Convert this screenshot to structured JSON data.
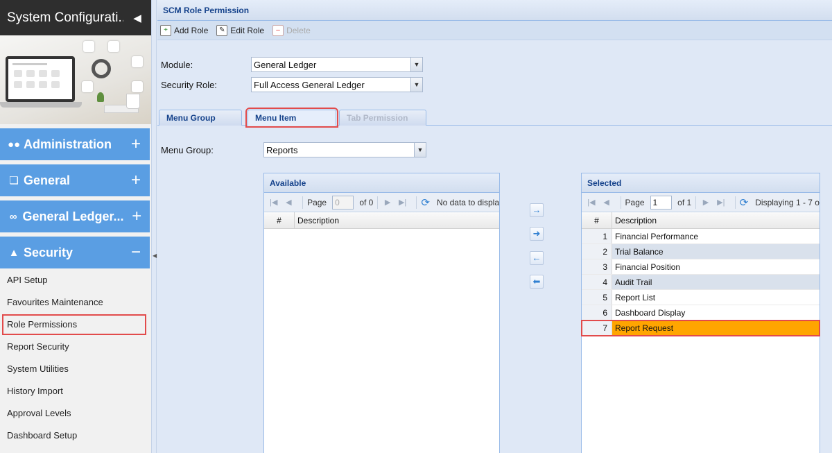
{
  "sidebar": {
    "title": "System Configurati...",
    "collapse_icon": "triangle-left-icon",
    "sections": {
      "administration": {
        "label": "Administration",
        "toggle": "+"
      },
      "general": {
        "label": "General",
        "toggle": "+"
      },
      "general_ledger": {
        "label": "General Ledger...",
        "toggle": "+"
      },
      "security": {
        "label": "Security",
        "toggle": "−"
      }
    },
    "items": [
      {
        "label": "API Setup"
      },
      {
        "label": "Favourites Maintenance"
      },
      {
        "label": "Role Permissions"
      },
      {
        "label": "Report Security"
      },
      {
        "label": "System Utilities"
      },
      {
        "label": "History Import"
      },
      {
        "label": "Approval Levels"
      },
      {
        "label": "Dashboard Setup"
      }
    ],
    "accent_color": "#5a9ee3",
    "highlight_color": "#e24b4b"
  },
  "panel": {
    "title": "SCM Role Permission",
    "toolbar": {
      "add_label": "Add Role",
      "edit_label": "Edit Role",
      "delete_label": "Delete"
    },
    "module": {
      "label": "Module:",
      "value": "General Ledger"
    },
    "security_role": {
      "label": "Security Role:",
      "value": "Full Access General Ledger"
    },
    "tabs": {
      "menu_group": "Menu Group",
      "menu_item": "Menu Item",
      "tab_permission": "Tab Permission"
    },
    "menu_group": {
      "label": "Menu Group:",
      "value": "Reports"
    }
  },
  "available_grid": {
    "title": "Available",
    "page_label": "Page",
    "page_value": "0",
    "of_label": "of 0",
    "status": "No data to displa",
    "col_num": "#",
    "col_desc": "Description"
  },
  "selected_grid": {
    "title": "Selected",
    "page_label": "Page",
    "page_value": "1",
    "of_label": "of 1",
    "status": "Displaying 1 - 7 o",
    "col_num": "#",
    "col_desc": "Description",
    "rows": [
      {
        "num": "1",
        "desc": "Financial Performance"
      },
      {
        "num": "2",
        "desc": "Trial Balance"
      },
      {
        "num": "3",
        "desc": "Financial Position"
      },
      {
        "num": "4",
        "desc": "Audit Trail"
      },
      {
        "num": "5",
        "desc": "Report List"
      },
      {
        "num": "6",
        "desc": "Dashboard Display"
      },
      {
        "num": "7",
        "desc": "Report Request"
      }
    ],
    "selected_row_color": "#ffa500"
  }
}
